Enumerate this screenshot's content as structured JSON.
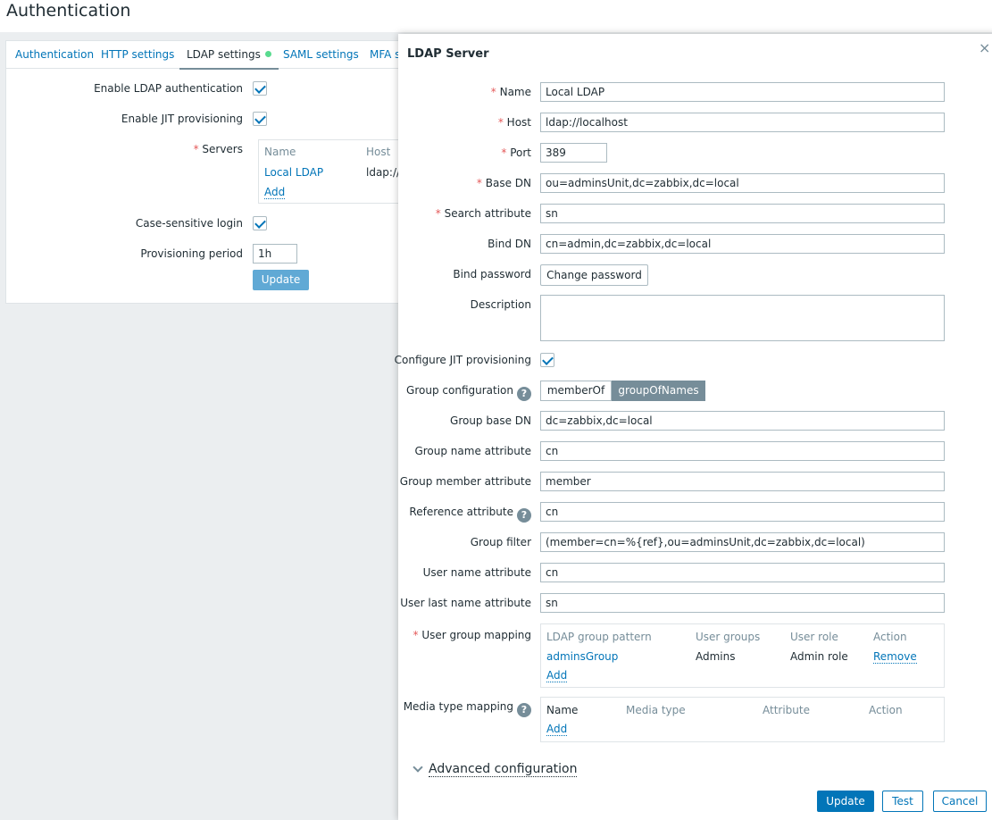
{
  "page": {
    "title": "Authentication"
  },
  "tabs": [
    {
      "label": "Authentication"
    },
    {
      "label": "HTTP settings"
    },
    {
      "label": "LDAP settings"
    },
    {
      "label": "SAML settings"
    },
    {
      "label": "MFA s"
    }
  ],
  "ldap_form": {
    "enable_ldap_label": "Enable LDAP authentication",
    "enable_jit_label": "Enable JIT provisioning",
    "servers_label": "Servers",
    "servers_table": {
      "headers": [
        "Name",
        "Host"
      ],
      "rows": [
        {
          "name": "Local LDAP",
          "host": "ldap://lo"
        }
      ],
      "add_label": "Add"
    },
    "case_sensitive_label": "Case-sensitive login",
    "provisioning_period_label": "Provisioning period",
    "provisioning_period_value": "1h",
    "update_label": "Update"
  },
  "dialog": {
    "title": "LDAP Server",
    "close_glyph": "×",
    "name_label": "Name",
    "name_value": "Local LDAP",
    "host_label": "Host",
    "host_value": "ldap://localhost",
    "port_label": "Port",
    "port_value": "389",
    "base_dn_label": "Base DN",
    "base_dn_value": "ou=adminsUnit,dc=zabbix,dc=local",
    "search_attr_label": "Search attribute",
    "search_attr_value": "sn",
    "bind_dn_label": "Bind DN",
    "bind_dn_value": "cn=admin,dc=zabbix,dc=local",
    "bind_password_label": "Bind password",
    "change_password_label": "Change password",
    "description_label": "Description",
    "description_value": "",
    "configure_jit_label": "Configure JIT provisioning",
    "group_config_label": "Group configuration",
    "group_config_options": [
      "memberOf",
      "groupOfNames"
    ],
    "group_config_selected": "groupOfNames",
    "group_base_dn_label": "Group base DN",
    "group_base_dn_value": "dc=zabbix,dc=local",
    "group_name_attr_label": "Group name attribute",
    "group_name_attr_value": "cn",
    "group_member_attr_label": "Group member attribute",
    "group_member_attr_value": "member",
    "reference_attr_label": "Reference attribute",
    "reference_attr_value": "cn",
    "group_filter_label": "Group filter",
    "group_filter_value": "(member=cn=%{ref},ou=adminsUnit,dc=zabbix,dc=local)",
    "user_name_attr_label": "User name attribute",
    "user_name_attr_value": "cn",
    "user_last_name_attr_label": "User last name attribute",
    "user_last_name_attr_value": "sn",
    "user_group_mapping_label": "User group mapping",
    "user_group_mapping": {
      "headers": [
        "LDAP group pattern",
        "User groups",
        "User role",
        "Action"
      ],
      "rows": [
        {
          "pattern": "adminsGroup",
          "groups": "Admins",
          "role": "Admin role",
          "action": "Remove"
        }
      ],
      "add_label": "Add"
    },
    "media_type_mapping_label": "Media type mapping",
    "media_type_mapping": {
      "headers": [
        "Name",
        "Media type",
        "Attribute",
        "Action"
      ],
      "add_label": "Add"
    },
    "advanced_label": "Advanced configuration",
    "buttons": {
      "update": "Update",
      "test": "Test",
      "cancel": "Cancel"
    },
    "help_glyph": "?"
  },
  "colors": {
    "accent": "#0275b8",
    "required": "#e45959",
    "muted": "#768d99",
    "status_ok": "#59db8f"
  }
}
